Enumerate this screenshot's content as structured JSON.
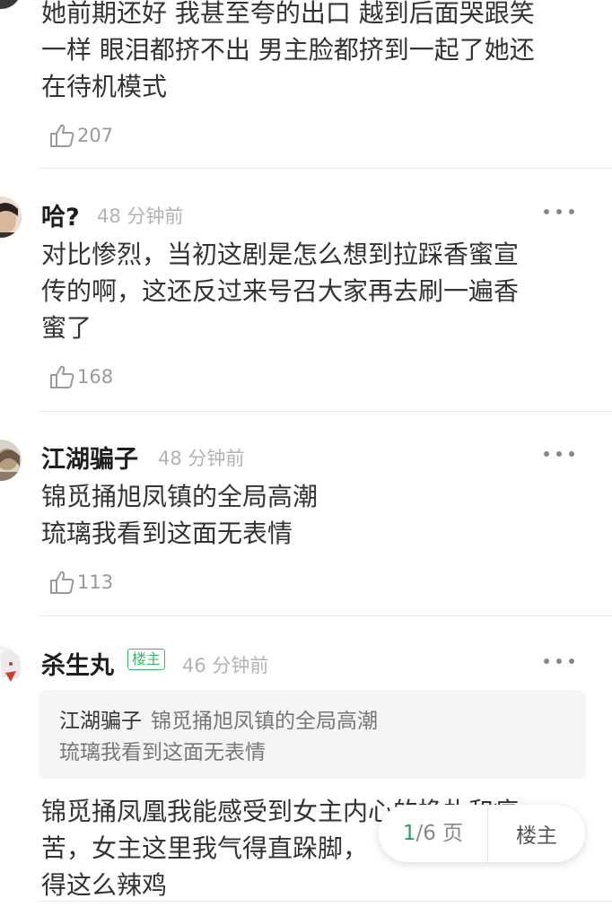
{
  "comments": [
    {
      "author": "",
      "time": "",
      "lines": [
        "她前期还好 我甚至夸的出口 越到后面哭跟笑",
        "一样 眼泪都挤不出 男主脸都挤到一起了她还",
        "在待机模式"
      ],
      "likes": "207"
    },
    {
      "author": "哈?",
      "time": "48 分钟前",
      "lines": [
        "对比惨烈，当初这剧是怎么想到拉踩香蜜宣",
        "传的啊，这还反过来号召大家再去刷一遍香",
        "蜜了"
      ],
      "likes": "168"
    },
    {
      "author": "江湖骗子",
      "time": "48 分钟前",
      "lines": [
        "锦觅捅旭凤镇的全局高潮",
        "琉璃我看到这面无表情"
      ],
      "likes": "113"
    },
    {
      "author": "杀生丸",
      "badge": "楼主",
      "time": "46 分钟前",
      "quote": {
        "author": "江湖骗子",
        "lines": [
          "锦觅捅旭凤镇的全局高潮",
          "琉璃我看到这面无表情"
        ]
      },
      "lines": [
        "锦觅捅凤凰我能感受到女主内心的挣扎和痛",
        "苦，女主这里我气得直跺脚，",
        "得这么辣鸡"
      ]
    }
  ],
  "pager": {
    "current": "1",
    "total": "/6 页",
    "owner_label": "楼主"
  },
  "colors": {
    "accent": "#3db86a",
    "muted": "#b3b3b3"
  },
  "icons": {
    "like": "thumbs-up-icon",
    "more": "more-dots-icon"
  }
}
